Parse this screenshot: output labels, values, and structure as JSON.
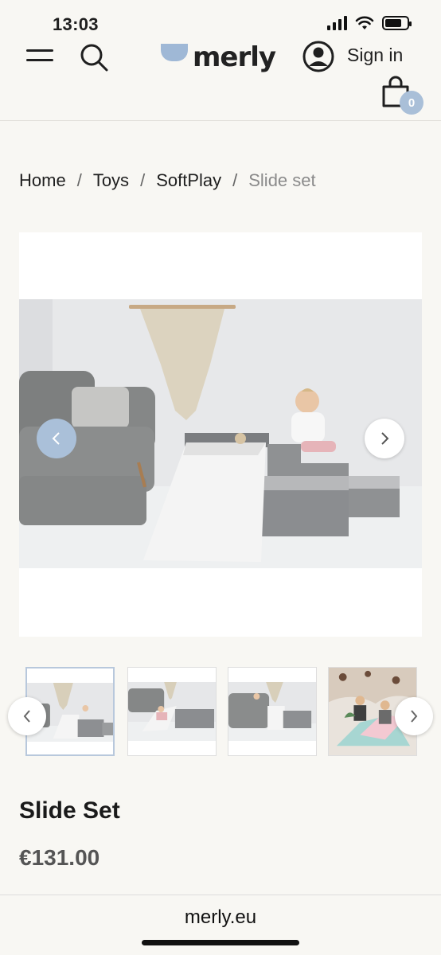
{
  "status": {
    "time": "13:03"
  },
  "header": {
    "logo": "merly",
    "signin": "Sign in",
    "cart_count": "0"
  },
  "breadcrumb": {
    "items": [
      "Home",
      "Toys",
      "SoftPlay"
    ],
    "current": "Slide set",
    "separator": "/"
  },
  "gallery": {
    "prev_icon": "chevron-left-icon",
    "next_icon": "chevron-right-icon",
    "thumbnail_count": 4,
    "active_index": 0
  },
  "product": {
    "title": "Slide Set",
    "price": "€131.00"
  },
  "browser": {
    "url": "merly.eu"
  },
  "colors": {
    "background": "#f8f7f3",
    "accent": "#a9bfd8",
    "text": "#1f1f1f",
    "muted": "#8a8a8a"
  }
}
